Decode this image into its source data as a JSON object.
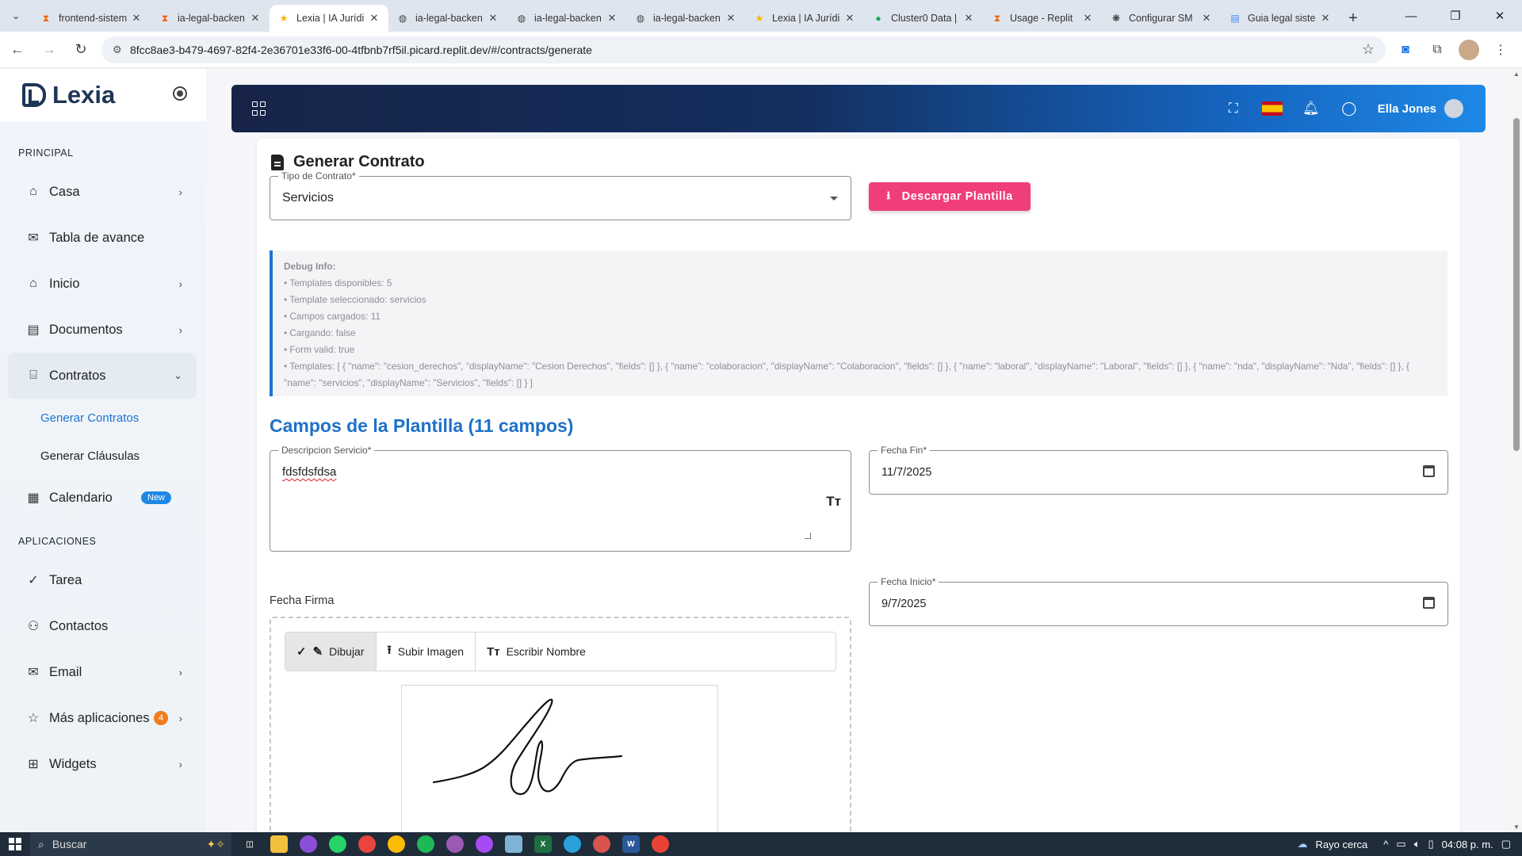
{
  "browser": {
    "tabs": [
      {
        "label": "frontend-sistem",
        "icon": "replit-icon",
        "icon_color": "#f26207"
      },
      {
        "label": "ia-legal-backen",
        "icon": "replit-icon",
        "icon_color": "#f26207"
      },
      {
        "label": "Lexia | IA Jurídi",
        "icon": "star-icon",
        "icon_color": "#f4b400",
        "active": true
      },
      {
        "label": "ia-legal-backen",
        "icon": "globe-icon",
        "icon_color": "#444444"
      },
      {
        "label": "ia-legal-backen",
        "icon": "globe-icon",
        "icon_color": "#444444"
      },
      {
        "label": "ia-legal-backen",
        "icon": "globe-icon",
        "icon_color": "#444444"
      },
      {
        "label": "Lexia | IA Jurídi",
        "icon": "star-icon",
        "icon_color": "#f4b400"
      },
      {
        "label": "Cluster0 Data |",
        "icon": "mongodb-icon",
        "icon_color": "#13aa52"
      },
      {
        "label": "Usage - Replit",
        "icon": "replit-icon",
        "icon_color": "#f26207"
      },
      {
        "label": "Configurar SM",
        "icon": "openai-icon",
        "icon_color": "#222222"
      },
      {
        "label": "Guia legal siste",
        "icon": "docs-icon",
        "icon_color": "#4285f4"
      }
    ],
    "url": "8fcc8ae3-b479-4697-82f4-2e36701e33f6-00-4tfbnb7rf5il.picard.replit.dev/#/contracts/generate"
  },
  "sidebar": {
    "brand": "Lexia",
    "section_principal": "PRINCIPAL",
    "section_apps": "APLICACIONES",
    "items_principal": [
      {
        "label": "Casa",
        "icon": "home-icon",
        "chevron": "›"
      },
      {
        "label": "Tabla de avance",
        "icon": "mail-icon",
        "chevron": ""
      },
      {
        "label": "Inicio",
        "icon": "home-icon",
        "chevron": "›"
      },
      {
        "label": "Documentos",
        "icon": "document-icon",
        "chevron": "›"
      },
      {
        "label": "Contratos",
        "icon": "building-icon",
        "chevron": "⌄"
      }
    ],
    "sub_items": [
      "Generar Contratos",
      "Generar Cláusulas"
    ],
    "calendar": {
      "label": "Calendario",
      "badge": "New"
    },
    "items_apps": [
      {
        "label": "Tarea",
        "icon": "check-circle-icon",
        "chevron": ""
      },
      {
        "label": "Contactos",
        "icon": "user-add-icon",
        "chevron": ""
      },
      {
        "label": "Email",
        "icon": "mail-icon",
        "chevron": "›"
      },
      {
        "label": "Más aplicaciones",
        "icon": "star-outline-icon",
        "chevron": "›",
        "badge": "4"
      },
      {
        "label": "Widgets",
        "icon": "gift-icon",
        "chevron": "›"
      }
    ]
  },
  "header": {
    "user_name": "Ella Jones"
  },
  "main": {
    "title": "Generar Contrato",
    "contract_type_label": "Tipo de Contrato*",
    "contract_type_value": "Servicios",
    "download_button": "Descargar Plantilla",
    "debug": {
      "title": "Debug Info:",
      "lines": [
        "• Templates disponibles: 5",
        "• Template seleccionado: servicios",
        "• Campos cargados: 11",
        "• Cargando: false",
        "• Form valid: true",
        "• Templates: [ { \"name\": \"cesion_derechos\", \"displayName\": \"Cesion Derechos\", \"fields\": [] }, { \"name\": \"colaboracion\", \"displayName\": \"Colaboracion\", \"fields\": [] }, { \"name\": \"laboral\", \"displayName\": \"Laboral\", \"fields\": [] }, { \"name\": \"nda\", \"displayName\": \"Nda\", \"fields\": [] }, { \"name\": \"servicios\", \"displayName\": \"Servicios\", \"fields\": [] } ]"
      ]
    },
    "section_title": "Campos de la Plantilla (11 campos)",
    "desc_label": "Descripcion Servicio*",
    "desc_value": "fdsfdsfdsa",
    "fecha_fin_label": "Fecha Fin*",
    "fecha_fin_value": "11/7/2025",
    "fecha_inicio_label": "Fecha Inicio*",
    "fecha_inicio_value": "9/7/2025",
    "firma_label": "Fecha Firma",
    "sig_tabs": [
      "Dibujar",
      "Subir Imagen",
      "Escribir Nombre"
    ]
  },
  "taskbar": {
    "search": "Buscar",
    "weather": "Rayo cerca",
    "time": "04:08 p. m."
  }
}
